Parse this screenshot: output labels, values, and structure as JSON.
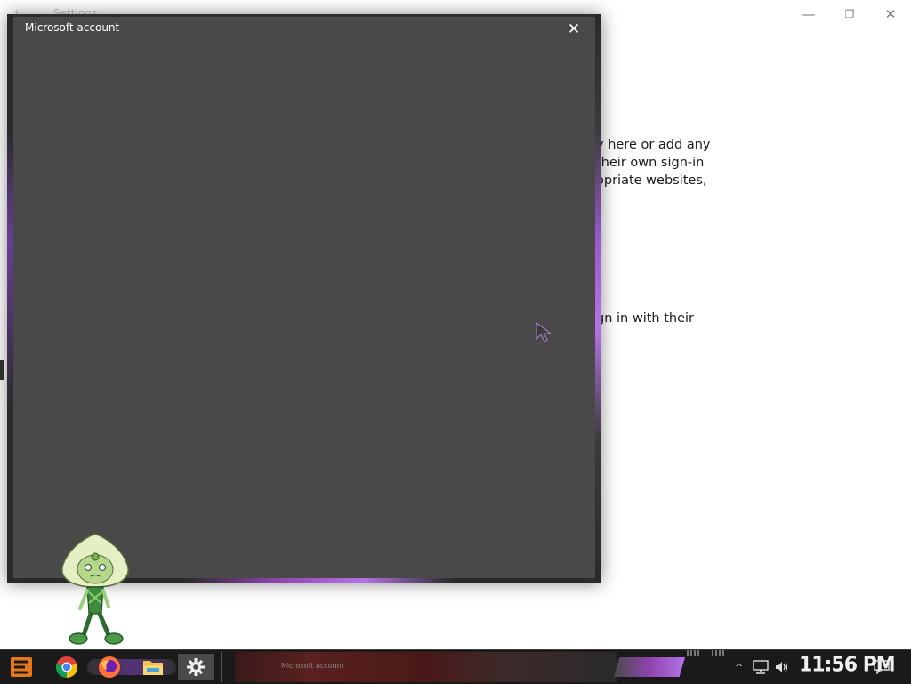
{
  "settings_window": {
    "back_glyph": "←",
    "title": "Settings",
    "minimize_glyph": "—",
    "restore_glyph": "❐",
    "close_glyph": "✕",
    "text_lines": [
      "y here or add any",
      " their own sign-in",
      "opriate websites,",
      "gn in with their"
    ]
  },
  "dialog": {
    "title": "Microsoft account",
    "close_glyph": "✕"
  },
  "taskbar": {
    "apps": [
      {
        "name": "chrome-icon"
      },
      {
        "name": "firefox-icon"
      },
      {
        "name": "file-explorer-icon"
      },
      {
        "name": "settings-gear-icon",
        "active": true
      }
    ],
    "band_text": "Microsoft account",
    "tray": {
      "chevron": "^",
      "network_icon": "network-icon",
      "volume_icon": "volume-icon",
      "action_center_icon": "action-center-icon"
    },
    "clock": "11:56 PM"
  },
  "colors": {
    "dialog_bg": "#494949",
    "accent_purple": "#b373e6",
    "taskbar_bg": "#1a1a1a"
  }
}
